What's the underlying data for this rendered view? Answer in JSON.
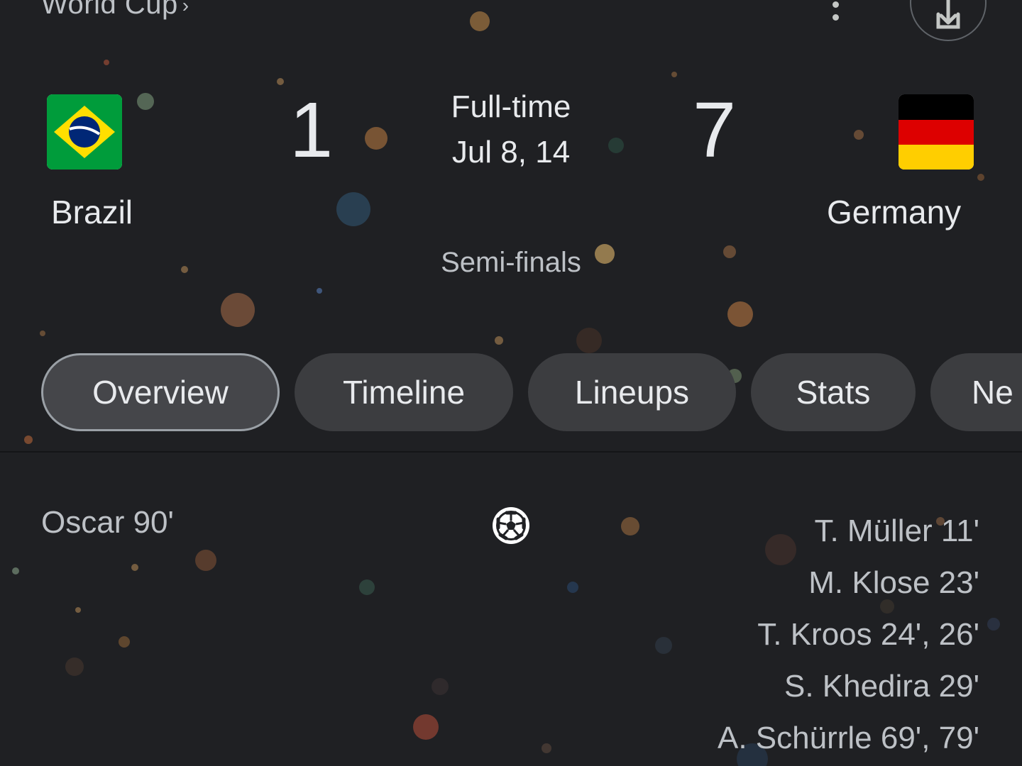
{
  "header": {
    "competition_link": "World Cup",
    "chevron": "›"
  },
  "icons": {
    "more": "more-vert-icon",
    "share": "share-icon",
    "goal": "soccer-ball-icon"
  },
  "match": {
    "home": {
      "name": "Brazil",
      "score": "1",
      "flag": "brazil-flag"
    },
    "away": {
      "name": "Germany",
      "score": "7",
      "flag": "germany-flag"
    },
    "status": "Full-time",
    "date": "Jul 8, 14",
    "round": "Semi-finals"
  },
  "tabs": [
    {
      "label": "Overview",
      "active": true
    },
    {
      "label": "Timeline",
      "active": false
    },
    {
      "label": "Lineups",
      "active": false
    },
    {
      "label": "Stats",
      "active": false
    },
    {
      "label": "Ne",
      "active": false
    }
  ],
  "goals": {
    "home": [
      "Oscar 90'"
    ],
    "away": [
      "T. Müller 11'",
      "M. Klose 23'",
      "T. Kroos 24', 26'",
      "S. Khedira 29'",
      "A. Schürrle 69', 79'"
    ]
  },
  "colors": {
    "background": "#1f2023",
    "text_primary": "#e8eaed",
    "text_secondary": "#bdc1c6",
    "chip_bg": "#3c3d40",
    "brazil_green": "#009c3b",
    "brazil_yellow": "#ffdf00",
    "brazil_blue": "#002776",
    "germany_black": "#000000",
    "germany_red": "#dd0000",
    "germany_gold": "#ffce00"
  }
}
